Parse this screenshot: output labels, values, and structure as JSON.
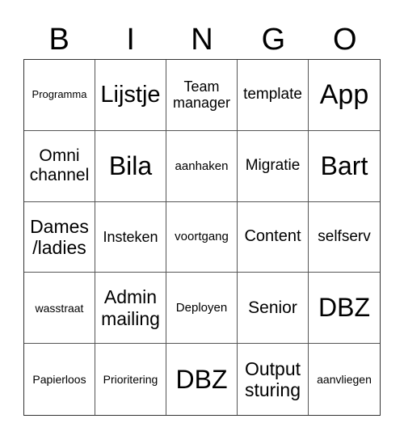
{
  "header": [
    "B",
    "I",
    "N",
    "G",
    "O"
  ],
  "cells": [
    "Programma",
    "Lijstje",
    "Team manager",
    "template",
    "App",
    "Omni channel",
    "Bila",
    "aanhaken",
    "Migratie",
    "Bart",
    "Dames /ladies",
    "Insteken",
    "voortgang",
    "Content",
    "selfserv",
    "wasstraat",
    "Admin mailing",
    "Deployen",
    "Senior",
    "DBZ",
    "Papierloos",
    "Prioritering",
    "DBZ",
    "Output sturing",
    "aanvliegen"
  ]
}
